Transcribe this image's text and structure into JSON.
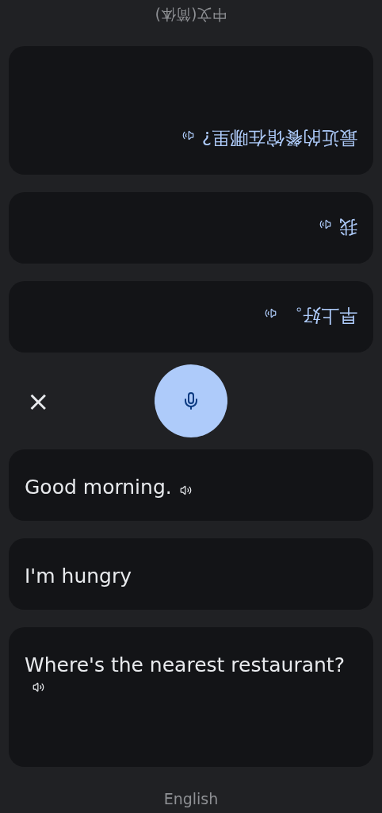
{
  "top_panel": {
    "language": "中文(简体)",
    "messages": [
      {
        "text": "早上好。",
        "speaker": true
      },
      {
        "text": "我",
        "speaker": true
      },
      {
        "text": "最近的餐馆在哪里?",
        "speaker": true
      }
    ]
  },
  "controls": {
    "close": "×"
  },
  "bottom_panel": {
    "language": "English",
    "messages": [
      {
        "text": "Good morning.",
        "speaker": true
      },
      {
        "text": "I'm hungry",
        "speaker": false
      },
      {
        "text": "Where's the nearest restaurant?",
        "speaker": true
      }
    ]
  }
}
